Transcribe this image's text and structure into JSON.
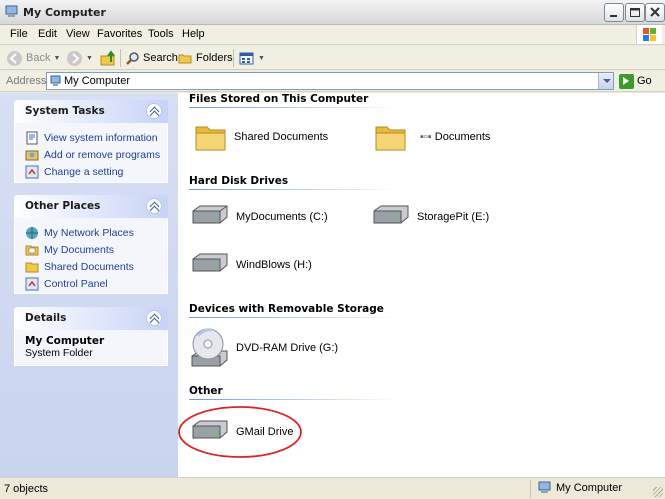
{
  "window": {
    "title": "My Computer"
  },
  "menu": [
    "File",
    "Edit",
    "View",
    "Favorites",
    "Tools",
    "Help"
  ],
  "toolbar": {
    "back": "Back",
    "search": "Search",
    "folders": "Folders"
  },
  "address": {
    "label": "Address",
    "value": "My Computer",
    "go": "Go"
  },
  "left": {
    "system_tasks": {
      "title": "System Tasks",
      "items": [
        "View system information",
        "Add or remove programs",
        "Change a setting"
      ]
    },
    "other_places": {
      "title": "Other Places",
      "items": [
        "My Network Places",
        "My Documents",
        "Shared Documents",
        "Control Panel"
      ]
    },
    "details": {
      "title": "Details",
      "name": "My Computer",
      "type": "System Folder"
    }
  },
  "groups": {
    "files": {
      "title": "Files Stored on This Computer",
      "items": [
        "Shared Documents",
        "Documents"
      ]
    },
    "drives": {
      "title": "Hard Disk Drives",
      "items": [
        "MyDocuments (C:)",
        "StoragePit (E:)",
        "WindBlows (H:)"
      ]
    },
    "removable": {
      "title": "Devices with Removable Storage",
      "items": [
        "DVD-RAM Drive (G:)"
      ]
    },
    "other": {
      "title": "Other",
      "items": [
        "GMail Drive"
      ]
    }
  },
  "status": {
    "objects": "7 objects",
    "location": "My Computer"
  },
  "colors": {
    "highlight_circle": "#d9262a",
    "link_blue": "#1f3f8f"
  }
}
